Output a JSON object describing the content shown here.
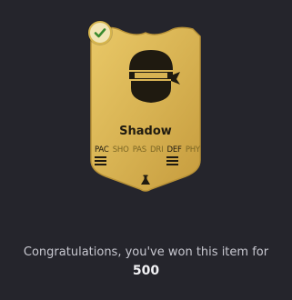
{
  "card": {
    "name": "Shadow",
    "avatar_icon": "ninja-icon",
    "badge_icon": "check-icon",
    "footer_icon": "flask-icon",
    "color": "#d4b04c",
    "stats": [
      {
        "label": "PAC",
        "active": true
      },
      {
        "label": "SHO",
        "active": false
      },
      {
        "label": "PAS",
        "active": false
      },
      {
        "label": "DRI",
        "active": false
      },
      {
        "label": "DEF",
        "active": true
      },
      {
        "label": "PHY",
        "active": false
      }
    ]
  },
  "message": {
    "text": "Congratulations, you've won this item for",
    "amount": "500"
  }
}
